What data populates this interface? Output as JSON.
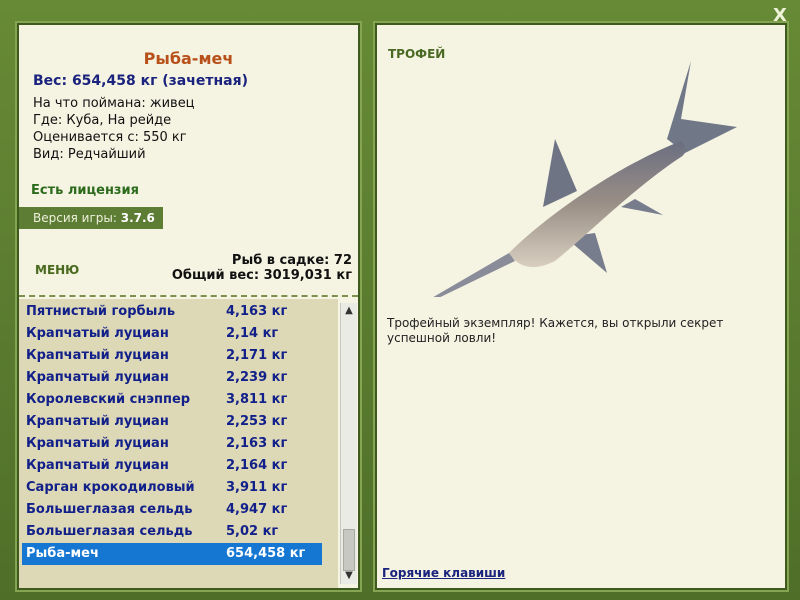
{
  "window": {
    "close_label": "X"
  },
  "fish": {
    "name": "Рыба-меч",
    "weight": "Вес: 654,458 кг (зачетная)",
    "caught_with": "На что поймана: живец",
    "location": "Где: Куба, На рейде",
    "valued_from": "Оценивается с: 550 кг",
    "rarity": "Вид: Редчайший"
  },
  "license": "Есть лицензия",
  "version": {
    "label": "Версия игры:",
    "value": "3.7.6"
  },
  "menu_label": "МЕНЮ",
  "stats": {
    "fish_count": "Рыб в садке: 72",
    "total_weight": "Общий вес: 3019,031 кг"
  },
  "catch_list": [
    {
      "name": "Пятнистый горбыль",
      "weight": "4,163 кг"
    },
    {
      "name": "Крапчатый луциан",
      "weight": "2,14 кг"
    },
    {
      "name": "Крапчатый луциан",
      "weight": "2,171 кг"
    },
    {
      "name": "Крапчатый луциан",
      "weight": "2,239 кг"
    },
    {
      "name": "Королевский снэппер",
      "weight": "3,811 кг"
    },
    {
      "name": "Крапчатый луциан",
      "weight": "2,253 кг"
    },
    {
      "name": "Крапчатый луциан",
      "weight": "2,163 кг"
    },
    {
      "name": "Крапчатый луциан",
      "weight": "2,164 кг"
    },
    {
      "name": "Сарган крокодиловый",
      "weight": "3,911 кг"
    },
    {
      "name": "Большеглазая сельдь",
      "weight": "4,947 кг"
    },
    {
      "name": "Большеглазая сельдь",
      "weight": "5,02 кг"
    },
    {
      "name": "Рыба-меч",
      "weight": "654,458 кг"
    }
  ],
  "selected_index": 11,
  "trophy": {
    "label": "ТРОФЕЙ",
    "text": "Трофейный экземпляр! Кажется, вы открыли секрет успешной ловли!",
    "image_icon": "swordfish-image"
  },
  "hotkeys_label": "Горячие клавиши",
  "colors": {
    "frame": "#5a7a30",
    "panel": "#f5f3e2",
    "selected": "#1677d2",
    "accent_name": "#b8501a"
  }
}
